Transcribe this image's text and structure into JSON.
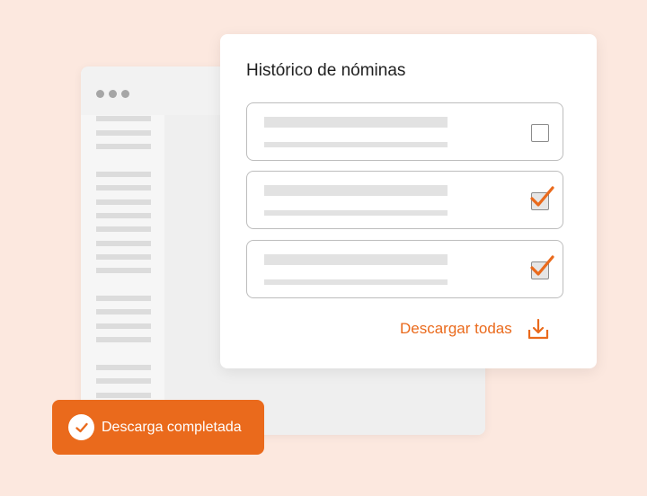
{
  "card": {
    "title": "Histórico de nóminas",
    "rows": [
      {
        "checked": false
      },
      {
        "checked": true
      },
      {
        "checked": true
      }
    ],
    "download_label": "Descargar todas",
    "download_icon": "download-icon"
  },
  "toast": {
    "message": "Descarga completada",
    "icon": "check-circle-icon"
  },
  "colors": {
    "accent": "#ea6a1c",
    "background": "#fce8df",
    "placeholder": "#e2e2e2"
  }
}
